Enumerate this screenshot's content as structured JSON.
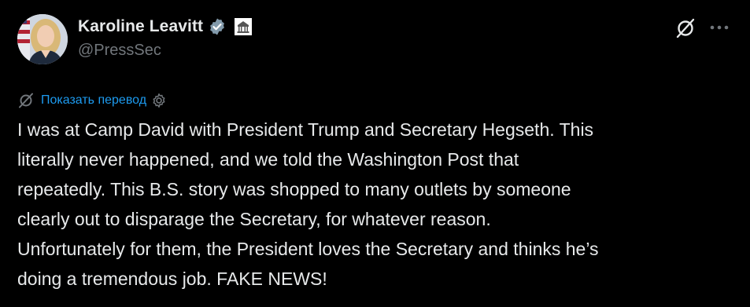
{
  "author": {
    "display_name": "Karoline Leavitt",
    "handle": "@PressSec",
    "verified_badge_icon": "verified-badge-icon",
    "affiliation_badge_icon": "white-house-badge-icon",
    "accent_color": "#1d9bf0"
  },
  "actions": {
    "grok_icon": "grok-icon",
    "more_icon": "more-horizontal-icon"
  },
  "translate": {
    "label": "Показать перевод",
    "color": "#1d9bf0"
  },
  "tweet": {
    "lines": [
      "I was at Camp David with President Trump and Secretary Hegseth. This",
      "literally never happened, and we told the Washington Post that",
      "repeatedly. This B.S. story was shopped to many outlets by someone",
      "clearly out to disparage the Secretary, for whatever reason.",
      "Unfortunately for them, the President loves the Secretary and thinks he’s",
      "doing a tremendous job. FAKE NEWS!"
    ]
  },
  "colors": {
    "background": "#000000",
    "text": "#e7e9ea",
    "secondary_text": "#71767b"
  }
}
